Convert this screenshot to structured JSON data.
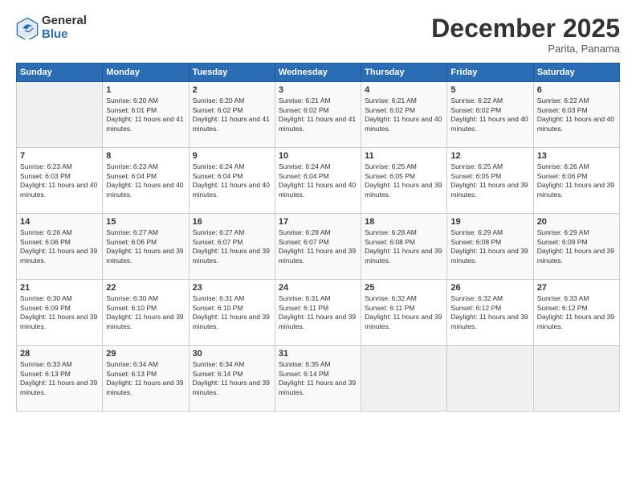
{
  "logo": {
    "general": "General",
    "blue": "Blue"
  },
  "header": {
    "month": "December 2025",
    "location": "Parita, Panama"
  },
  "weekdays": [
    "Sunday",
    "Monday",
    "Tuesday",
    "Wednesday",
    "Thursday",
    "Friday",
    "Saturday"
  ],
  "weeks": [
    [
      {
        "day": "",
        "empty": true
      },
      {
        "day": "1",
        "sunrise": "Sunrise: 6:20 AM",
        "sunset": "Sunset: 6:01 PM",
        "daylight": "Daylight: 11 hours and 41 minutes."
      },
      {
        "day": "2",
        "sunrise": "Sunrise: 6:20 AM",
        "sunset": "Sunset: 6:02 PM",
        "daylight": "Daylight: 11 hours and 41 minutes."
      },
      {
        "day": "3",
        "sunrise": "Sunrise: 6:21 AM",
        "sunset": "Sunset: 6:02 PM",
        "daylight": "Daylight: 11 hours and 41 minutes."
      },
      {
        "day": "4",
        "sunrise": "Sunrise: 6:21 AM",
        "sunset": "Sunset: 6:02 PM",
        "daylight": "Daylight: 11 hours and 40 minutes."
      },
      {
        "day": "5",
        "sunrise": "Sunrise: 6:22 AM",
        "sunset": "Sunset: 6:02 PM",
        "daylight": "Daylight: 11 hours and 40 minutes."
      },
      {
        "day": "6",
        "sunrise": "Sunrise: 6:22 AM",
        "sunset": "Sunset: 6:03 PM",
        "daylight": "Daylight: 11 hours and 40 minutes."
      }
    ],
    [
      {
        "day": "7",
        "sunrise": "Sunrise: 6:23 AM",
        "sunset": "Sunset: 6:03 PM",
        "daylight": "Daylight: 11 hours and 40 minutes."
      },
      {
        "day": "8",
        "sunrise": "Sunrise: 6:23 AM",
        "sunset": "Sunset: 6:04 PM",
        "daylight": "Daylight: 11 hours and 40 minutes."
      },
      {
        "day": "9",
        "sunrise": "Sunrise: 6:24 AM",
        "sunset": "Sunset: 6:04 PM",
        "daylight": "Daylight: 11 hours and 40 minutes."
      },
      {
        "day": "10",
        "sunrise": "Sunrise: 6:24 AM",
        "sunset": "Sunset: 6:04 PM",
        "daylight": "Daylight: 11 hours and 40 minutes."
      },
      {
        "day": "11",
        "sunrise": "Sunrise: 6:25 AM",
        "sunset": "Sunset: 6:05 PM",
        "daylight": "Daylight: 11 hours and 39 minutes."
      },
      {
        "day": "12",
        "sunrise": "Sunrise: 6:25 AM",
        "sunset": "Sunset: 6:05 PM",
        "daylight": "Daylight: 11 hours and 39 minutes."
      },
      {
        "day": "13",
        "sunrise": "Sunrise: 6:26 AM",
        "sunset": "Sunset: 6:06 PM",
        "daylight": "Daylight: 11 hours and 39 minutes."
      }
    ],
    [
      {
        "day": "14",
        "sunrise": "Sunrise: 6:26 AM",
        "sunset": "Sunset: 6:06 PM",
        "daylight": "Daylight: 11 hours and 39 minutes."
      },
      {
        "day": "15",
        "sunrise": "Sunrise: 6:27 AM",
        "sunset": "Sunset: 6:06 PM",
        "daylight": "Daylight: 11 hours and 39 minutes."
      },
      {
        "day": "16",
        "sunrise": "Sunrise: 6:27 AM",
        "sunset": "Sunset: 6:07 PM",
        "daylight": "Daylight: 11 hours and 39 minutes."
      },
      {
        "day": "17",
        "sunrise": "Sunrise: 6:28 AM",
        "sunset": "Sunset: 6:07 PM",
        "daylight": "Daylight: 11 hours and 39 minutes."
      },
      {
        "day": "18",
        "sunrise": "Sunrise: 6:28 AM",
        "sunset": "Sunset: 6:08 PM",
        "daylight": "Daylight: 11 hours and 39 minutes."
      },
      {
        "day": "19",
        "sunrise": "Sunrise: 6:29 AM",
        "sunset": "Sunset: 6:08 PM",
        "daylight": "Daylight: 11 hours and 39 minutes."
      },
      {
        "day": "20",
        "sunrise": "Sunrise: 6:29 AM",
        "sunset": "Sunset: 6:09 PM",
        "daylight": "Daylight: 11 hours and 39 minutes."
      }
    ],
    [
      {
        "day": "21",
        "sunrise": "Sunrise: 6:30 AM",
        "sunset": "Sunset: 6:09 PM",
        "daylight": "Daylight: 11 hours and 39 minutes."
      },
      {
        "day": "22",
        "sunrise": "Sunrise: 6:30 AM",
        "sunset": "Sunset: 6:10 PM",
        "daylight": "Daylight: 11 hours and 39 minutes."
      },
      {
        "day": "23",
        "sunrise": "Sunrise: 6:31 AM",
        "sunset": "Sunset: 6:10 PM",
        "daylight": "Daylight: 11 hours and 39 minutes."
      },
      {
        "day": "24",
        "sunrise": "Sunrise: 6:31 AM",
        "sunset": "Sunset: 6:11 PM",
        "daylight": "Daylight: 11 hours and 39 minutes."
      },
      {
        "day": "25",
        "sunrise": "Sunrise: 6:32 AM",
        "sunset": "Sunset: 6:11 PM",
        "daylight": "Daylight: 11 hours and 39 minutes."
      },
      {
        "day": "26",
        "sunrise": "Sunrise: 6:32 AM",
        "sunset": "Sunset: 6:12 PM",
        "daylight": "Daylight: 11 hours and 39 minutes."
      },
      {
        "day": "27",
        "sunrise": "Sunrise: 6:33 AM",
        "sunset": "Sunset: 6:12 PM",
        "daylight": "Daylight: 11 hours and 39 minutes."
      }
    ],
    [
      {
        "day": "28",
        "sunrise": "Sunrise: 6:33 AM",
        "sunset": "Sunset: 6:13 PM",
        "daylight": "Daylight: 11 hours and 39 minutes."
      },
      {
        "day": "29",
        "sunrise": "Sunrise: 6:34 AM",
        "sunset": "Sunset: 6:13 PM",
        "daylight": "Daylight: 11 hours and 39 minutes."
      },
      {
        "day": "30",
        "sunrise": "Sunrise: 6:34 AM",
        "sunset": "Sunset: 6:14 PM",
        "daylight": "Daylight: 11 hours and 39 minutes."
      },
      {
        "day": "31",
        "sunrise": "Sunrise: 6:35 AM",
        "sunset": "Sunset: 6:14 PM",
        "daylight": "Daylight: 11 hours and 39 minutes."
      },
      {
        "day": "",
        "empty": true
      },
      {
        "day": "",
        "empty": true
      },
      {
        "day": "",
        "empty": true
      }
    ]
  ]
}
